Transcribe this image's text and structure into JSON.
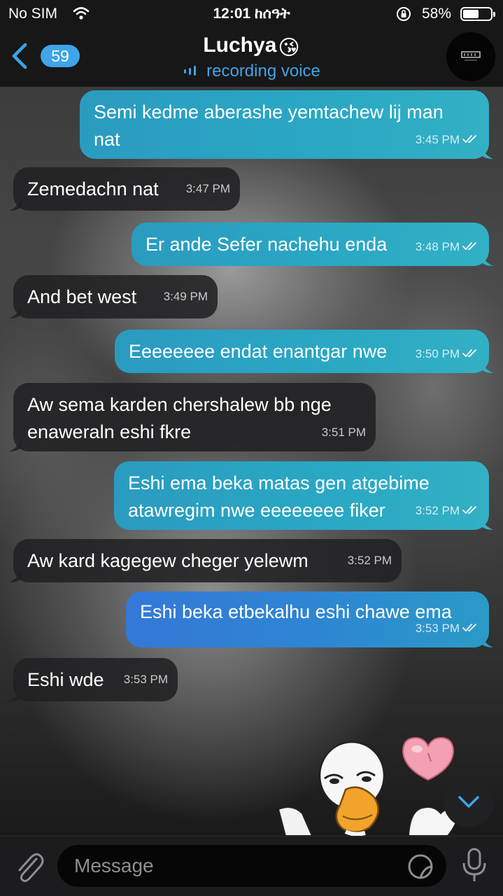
{
  "status_bar": {
    "carrier": "No SIM",
    "time": "12:01 ከሰዓት",
    "battery_percent": "58%",
    "battery_level": 0.58
  },
  "header": {
    "back_count": "59",
    "title": "Luchya",
    "title_emoji": "😘",
    "subtitle": "recording voice",
    "avatar_icon": "channel-logo-icon"
  },
  "messages": [
    {
      "direction": "outgoing",
      "text_lines": [
        "Semi kedme aberashe yemtachew lij man",
        "nat"
      ],
      "time": "3:45 PM",
      "read": true
    },
    {
      "direction": "incoming",
      "text_lines": [
        "Zemedachn nat"
      ],
      "time": "3:47 PM"
    },
    {
      "direction": "outgoing",
      "text_lines": [
        "Er ande Sefer nachehu enda"
      ],
      "time": "3:48 PM",
      "read": true
    },
    {
      "direction": "incoming",
      "text_lines": [
        "And bet west"
      ],
      "time": "3:49 PM"
    },
    {
      "direction": "outgoing",
      "text_lines": [
        "Eeeeeeee endat enantgar nwe"
      ],
      "time": "3:50 PM",
      "read": true
    },
    {
      "direction": "incoming",
      "text_lines": [
        "Aw sema karden chershalew bb nge",
        "enaweraln eshi fkre"
      ],
      "time": "3:51 PM"
    },
    {
      "direction": "outgoing",
      "text_lines": [
        "Eshi ema beka matas gen atgebime",
        "atawregim nwe eeeeeeee fiker"
      ],
      "time": "3:52 PM",
      "read": true
    },
    {
      "direction": "incoming",
      "text_lines": [
        "Aw kard kagegew cheger yelewm"
      ],
      "time": "3:52 PM"
    },
    {
      "direction": "outgoing",
      "text_lines": [
        "Eshi beka etbekalhu eshi chawe ema"
      ],
      "time": "3:53 PM",
      "read": true
    },
    {
      "direction": "incoming",
      "text_lines": [
        "Eshi wde"
      ],
      "time": "3:53 PM"
    }
  ],
  "input": {
    "placeholder": "Message"
  },
  "colors": {
    "accent": "#3fa4e8",
    "outgoing_bubble": "#2aa8c4",
    "incoming_bubble": "#212123",
    "bar_background": "#171717"
  }
}
